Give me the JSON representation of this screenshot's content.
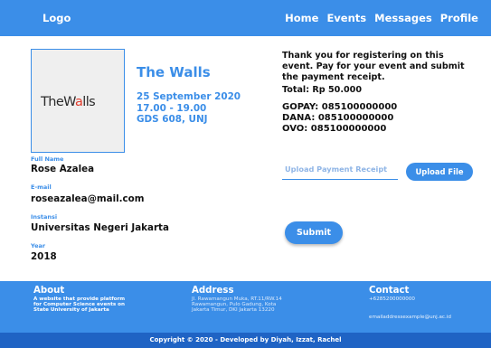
{
  "nav": {
    "logo": "Logo",
    "links": [
      "Home",
      "Events",
      "Messages",
      "Profile"
    ]
  },
  "event": {
    "image_brand_pre": "The",
    "image_brand_mid": "W",
    "image_brand_accent": "a",
    "image_brand_post": "lls",
    "title": "The Walls",
    "date": "25 September 2020",
    "time": "17.00 - 19.00",
    "location": "GDS 608, UNJ"
  },
  "user": {
    "full_name_label": "Full Name",
    "full_name": "Rose Azalea",
    "email_label": "E-mail",
    "email": "roseazalea@mail.com",
    "instansi_label": "Instansi",
    "instansi": "Universitas Negeri Jakarta",
    "year_label": "Year",
    "year": "2018"
  },
  "payment": {
    "message_line1": "Thank you for registering on this",
    "message_line2": "event. Pay for your event and submit",
    "message_line3": "the payment receipt.",
    "total": "Total: Rp 50.000",
    "accounts": [
      "GOPAY: 085100000000",
      "DANA: 085100000000",
      "OVO: 085100000000"
    ],
    "upload_placeholder": "Upload Payment Receipt",
    "upload_button": "Upload File",
    "submit_button": "Submit"
  },
  "footer": {
    "about_title": "About",
    "about_lines": [
      "A website that provide platform",
      "for Computer Science events on",
      "State University of Jakarta"
    ],
    "address_title": "Address",
    "address_lines": [
      "Jl. Rawamangun Muka, RT.11/RW.14",
      "Rawamangun, Pulo Gadung, Kota",
      "Jakarta Timur, DKI Jakarta 13220"
    ],
    "contact_title": "Contact",
    "contact_phone": "+6285200000000",
    "contact_email": "emailaddressexample@unj.ac.id",
    "copyright": "Copyright © 2020 - Developed by Diyah, Izzat, Rachel"
  },
  "colors": {
    "primary": "#3b8ee8",
    "footer_bottom": "#1f63c4",
    "brand_accent": "#e03a2a"
  }
}
